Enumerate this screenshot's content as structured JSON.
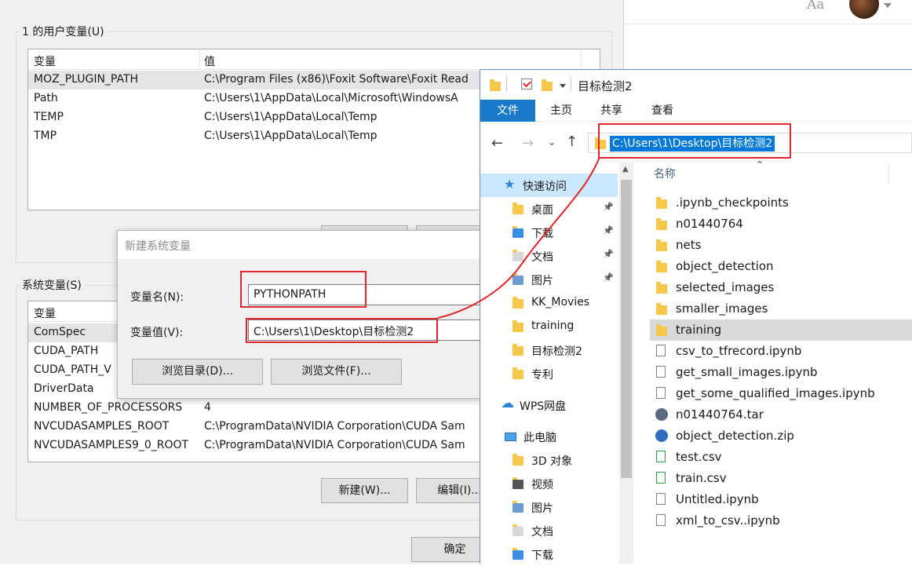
{
  "top_right": {
    "font_btn": "Aa"
  },
  "env_window": {
    "user_vars": {
      "title": "1 的用户变量(U)",
      "col_var": "变量",
      "col_val": "值",
      "rows": [
        {
          "name": "MOZ_PLUGIN_PATH",
          "value": "C:\\Program Files (x86)\\Foxit Software\\Foxit Read"
        },
        {
          "name": "Path",
          "value": "C:\\Users\\1\\AppData\\Local\\Microsoft\\WindowsA"
        },
        {
          "name": "TEMP",
          "value": "C:\\Users\\1\\AppData\\Local\\Temp"
        },
        {
          "name": "TMP",
          "value": "C:\\Users\\1\\AppData\\Local\\Temp"
        }
      ]
    },
    "sys_vars": {
      "title": "系统变量(S)",
      "col_var": "变量",
      "rows": [
        {
          "name": "ComSpec",
          "value": ""
        },
        {
          "name": "CUDA_PATH",
          "value": ""
        },
        {
          "name": "CUDA_PATH_V",
          "value": ""
        },
        {
          "name": "DriverData",
          "value": ""
        },
        {
          "name": "NUMBER_OF_PROCESSORS",
          "value": "4"
        },
        {
          "name": "NVCUDASAMPLES_ROOT",
          "value": "C:\\ProgramData\\NVIDIA Corporation\\CUDA Sam"
        },
        {
          "name": "NVCUDASAMPLES9_0_ROOT",
          "value": "C:\\ProgramData\\NVIDIA Corporation\\CUDA Sam"
        }
      ],
      "new_btn": "新建(W)...",
      "edit_btn": "编辑(I)..."
    },
    "ok_btn": "确定"
  },
  "new_var_dialog": {
    "title": "新建系统变量",
    "name_label": "变量名(N):",
    "name_value": "PYTHONPATH",
    "value_label": "变量值(V):",
    "value_value": "C:\\Users\\1\\Desktop\\目标检测2",
    "browse_dir": "浏览目录(D)...",
    "browse_file": "浏览文件(F)..."
  },
  "explorer": {
    "title": "目标检测2",
    "tabs": [
      "文件",
      "主页",
      "共享",
      "查看"
    ],
    "address": "C:\\Users\\1\\Desktop\\目标检测2",
    "col_name": "名称",
    "nav": [
      {
        "label": "快速访问",
        "type": "star"
      },
      {
        "label": "桌面",
        "type": "folder",
        "pin": true
      },
      {
        "label": "下载",
        "type": "download",
        "pin": true
      },
      {
        "label": "文档",
        "type": "doc",
        "pin": true
      },
      {
        "label": "图片",
        "type": "pic",
        "pin": true
      },
      {
        "label": "KK_Movies",
        "type": "folder",
        "pin": false
      },
      {
        "label": "training",
        "type": "folder",
        "pin": false
      },
      {
        "label": "目标检测2",
        "type": "folder",
        "pin": false
      },
      {
        "label": "专利",
        "type": "folder",
        "pin": false
      },
      {
        "label": "WPS网盘",
        "type": "cloud"
      },
      {
        "label": "此电脑",
        "type": "pc"
      },
      {
        "label": "3D 对象",
        "type": "folder"
      },
      {
        "label": "视频",
        "type": "video"
      },
      {
        "label": "图片",
        "type": "pic"
      },
      {
        "label": "文档",
        "type": "doc"
      },
      {
        "label": "下载",
        "type": "download"
      }
    ],
    "files": [
      {
        "name": ".ipynb_checkpoints",
        "type": "folder"
      },
      {
        "name": "n01440764",
        "type": "folder"
      },
      {
        "name": "nets",
        "type": "folder"
      },
      {
        "name": "object_detection",
        "type": "folder"
      },
      {
        "name": "selected_images",
        "type": "folder"
      },
      {
        "name": "smaller_images",
        "type": "folder"
      },
      {
        "name": "training",
        "type": "folder"
      },
      {
        "name": "csv_to_tfrecord.ipynb",
        "type": "file"
      },
      {
        "name": "get_small_images.ipynb",
        "type": "file"
      },
      {
        "name": "get_some_qualified_images.ipynb",
        "type": "file"
      },
      {
        "name": "n01440764.tar",
        "type": "tar"
      },
      {
        "name": "object_detection.zip",
        "type": "zip"
      },
      {
        "name": "test.csv",
        "type": "csv"
      },
      {
        "name": "train.csv",
        "type": "csv"
      },
      {
        "name": "Untitled.ipynb",
        "type": "file"
      },
      {
        "name": "xml_to_csv..ipynb",
        "type": "file"
      }
    ],
    "selected_file": "training"
  },
  "colors": {
    "accent": "#1979ca",
    "highlight": "#e0262b",
    "selection": "#0078d7"
  }
}
